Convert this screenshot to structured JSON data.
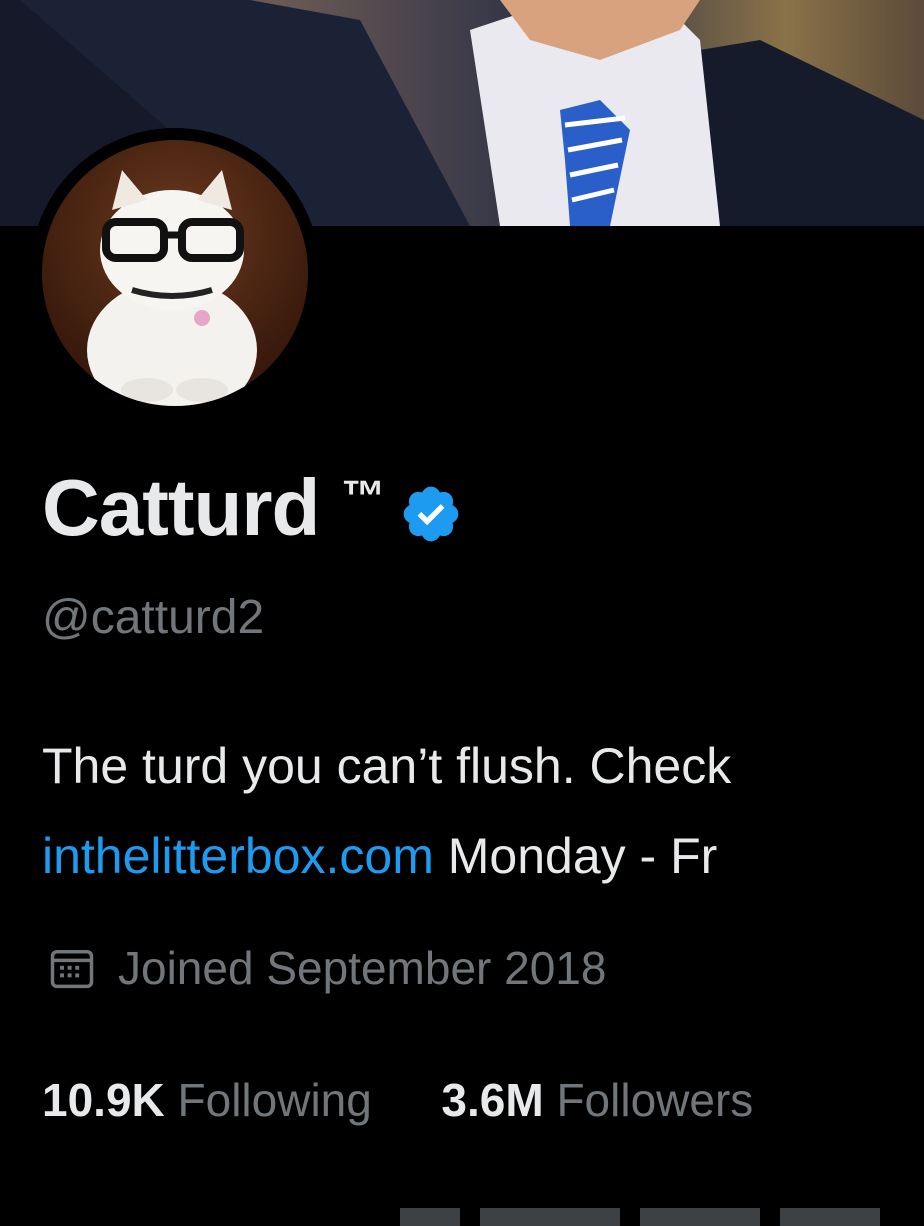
{
  "profile": {
    "display_name": "Catturd",
    "trademark": "™",
    "handle": "@catturd2",
    "verified_icon": "verified-badge-icon",
    "verified_color": "#1d9bf0",
    "bio_line1": "The turd you can’t flush. Check",
    "bio_link": "inthelitterbox.com",
    "bio_line2_rest": " Monday - Fr",
    "joined": "Joined September 2018",
    "calendar_icon": "calendar-icon"
  },
  "stats": {
    "following_count": "10.9K",
    "following_label": "Following",
    "followers_count": "3.6M",
    "followers_label": "Followers"
  },
  "colors": {
    "background": "#000000",
    "text_primary": "#e7e9ea",
    "text_secondary": "#71767b",
    "link": "#1d9bf0"
  }
}
